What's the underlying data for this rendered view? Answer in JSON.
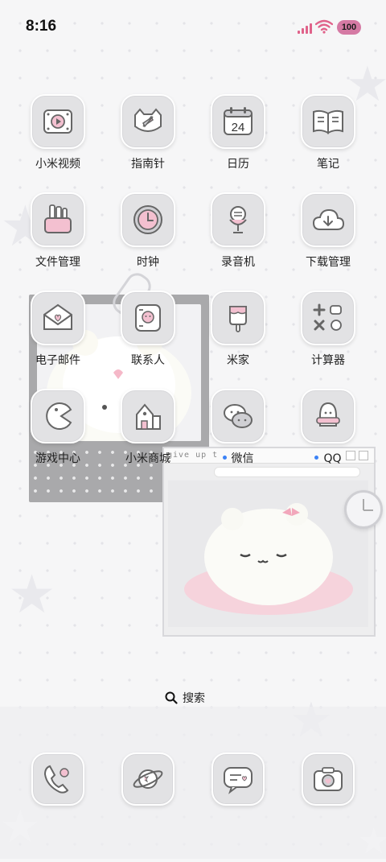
{
  "status": {
    "time": "8:16",
    "battery": "100",
    "accent": "#d57aa4"
  },
  "apps": [
    {
      "label": "小米视频",
      "icon": "video-player-icon"
    },
    {
      "label": "指南针",
      "icon": "compass-icon"
    },
    {
      "label": "日历",
      "icon": "calendar-icon",
      "day": "24"
    },
    {
      "label": "笔记",
      "icon": "notebook-icon"
    },
    {
      "label": "文件管理",
      "icon": "folder-icon"
    },
    {
      "label": "时钟",
      "icon": "clock-icon"
    },
    {
      "label": "录音机",
      "icon": "microphone-icon"
    },
    {
      "label": "下载管理",
      "icon": "cloud-download-icon"
    },
    {
      "label": "电子邮件",
      "icon": "envelope-icon"
    },
    {
      "label": "联系人",
      "icon": "contacts-icon"
    },
    {
      "label": "米家",
      "icon": "popsicle-icon"
    },
    {
      "label": "计算器",
      "icon": "calculator-icon"
    },
    {
      "label": "游戏中心",
      "icon": "pacman-icon"
    },
    {
      "label": "小米商城",
      "icon": "house-icon"
    },
    {
      "label": "微信",
      "icon": "wechat-icon"
    },
    {
      "label": "QQ",
      "icon": "penguin-icon"
    }
  ],
  "search": {
    "label": "搜索"
  },
  "browser_widget": {
    "title_text": "give up t"
  },
  "dock": [
    {
      "icon": "phone-icon"
    },
    {
      "icon": "planet-browser-icon"
    },
    {
      "icon": "message-icon"
    },
    {
      "icon": "camera-icon"
    }
  ]
}
